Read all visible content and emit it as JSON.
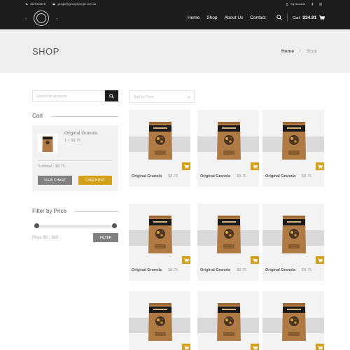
{
  "topbar": {
    "phone": "0821345678",
    "email": "giorgio@georgieporgie.com.au",
    "account": "My Account"
  },
  "logo": {
    "left_mark": "»",
    "right_mark": "«"
  },
  "nav": {
    "items": [
      "Home",
      "Shop",
      "About Us",
      "Contact"
    ]
  },
  "header_cart": {
    "label": "Cart",
    "total": "$34.91"
  },
  "page": {
    "title": "SHOP",
    "breadcrumb_home": "Home",
    "breadcrumb_sep": "/",
    "breadcrumb_current": "Shop"
  },
  "search": {
    "placeholder": "Search for products"
  },
  "sort": {
    "placeholder": "Sort by Price"
  },
  "cart_widget": {
    "title": "Cart",
    "item_name": "Original Granola",
    "item_qty": "1 × $8.75",
    "subtotal": "Subtotal : $8.75",
    "view_cart": "VIEW CHART",
    "checkout": "CHECKOUT"
  },
  "price_filter": {
    "title": "Filter by Price",
    "range": "Price $0 - $60",
    "button": "FILTER",
    "min_fraction": 0,
    "max_fraction": 1
  },
  "products": [
    {
      "name": "Original Granola",
      "price": "$8.75"
    },
    {
      "name": "Original Granola",
      "price": "$8.75"
    },
    {
      "name": "Original Granola",
      "price": "$8.75"
    },
    {
      "name": "Original Granola",
      "price": "$8.75"
    },
    {
      "name": "Original Granola",
      "price": "$8.75"
    },
    {
      "name": "Original Granola",
      "price": "$8.75"
    },
    {
      "name": "",
      "price": ""
    },
    {
      "name": "",
      "price": ""
    },
    {
      "name": "",
      "price": ""
    }
  ],
  "colors": {
    "header_bg": "#1d1d1d",
    "accent": "#d4a017",
    "button_gray": "#808080"
  }
}
